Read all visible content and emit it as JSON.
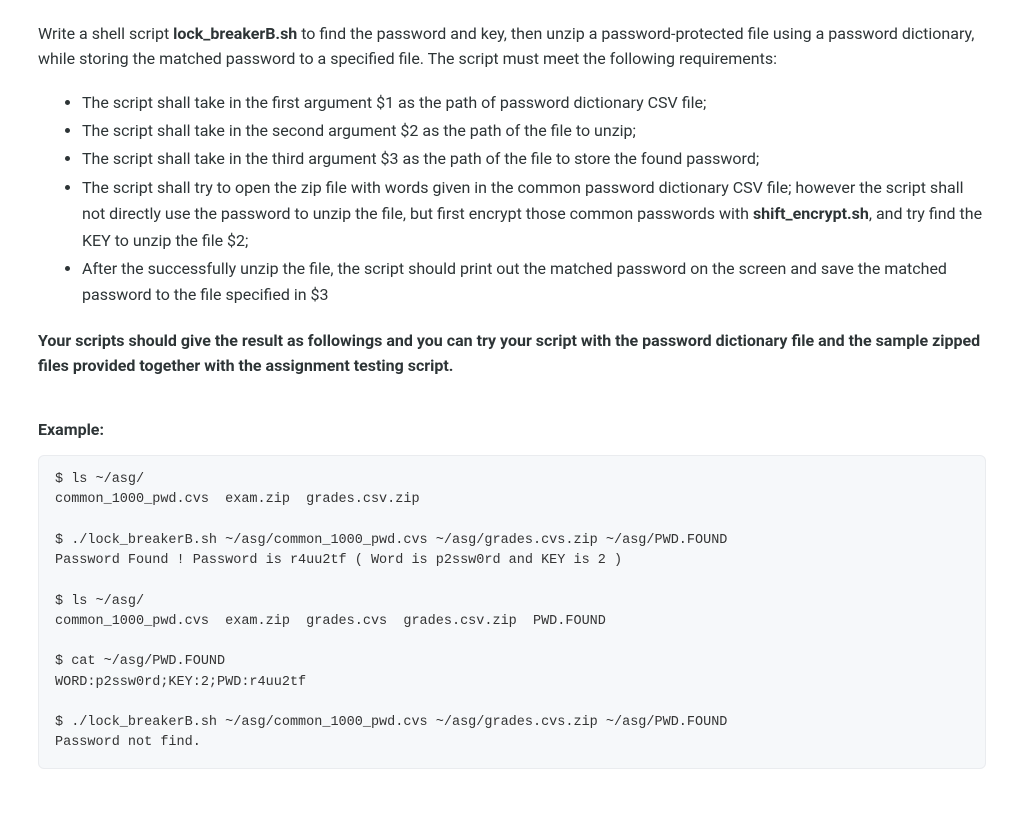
{
  "intro": {
    "pre": "Write a shell script ",
    "script_name": "lock_breakerB.sh",
    "post": " to find the password and key, then unzip a password-protected file using a password dictionary, while storing the matched password to a specified file. The script must meet the following requirements:"
  },
  "requirements": [
    {
      "text": "The script shall take in the first argument $1 as the path of password dictionary CSV file;"
    },
    {
      "text": "The script shall take in the second argument $2 as the path of the file to unzip;"
    },
    {
      "text": "The script shall take in the third argument $3 as the path of the file to store the found password;"
    },
    {
      "pre": "The script shall try to open the zip file with words given in the common password dictionary CSV file; however the script shall not directly use the password to unzip the file, but first encrypt those common passwords with ",
      "bold": "shift_encrypt.sh",
      "post": ", and try find the KEY to unzip the file $2;"
    },
    {
      "text": "After the successfully unzip the file, the script should print out the matched password on the screen and save the matched password to the file specified in $3"
    }
  ],
  "result_note": "Your scripts should give the result as followings and you can try your script with the password dictionary file and the sample zipped files provided together with the assignment testing script.",
  "example_label": "Example:",
  "code": "$ ls ~/asg/\ncommon_1000_pwd.cvs  exam.zip  grades.csv.zip\n\n$ ./lock_breakerB.sh ~/asg/common_1000_pwd.cvs ~/asg/grades.cvs.zip ~/asg/PWD.FOUND\nPassword Found ! Password is r4uu2tf ( Word is p2ssw0rd and KEY is 2 )\n\n$ ls ~/asg/\ncommon_1000_pwd.cvs  exam.zip  grades.cvs  grades.csv.zip  PWD.FOUND\n\n$ cat ~/asg/PWD.FOUND\nWORD:p2ssw0rd;KEY:2;PWD:r4uu2tf\n\n$ ./lock_breakerB.sh ~/asg/common_1000_pwd.cvs ~/asg/grades.cvs.zip ~/asg/PWD.FOUND\nPassword not find."
}
